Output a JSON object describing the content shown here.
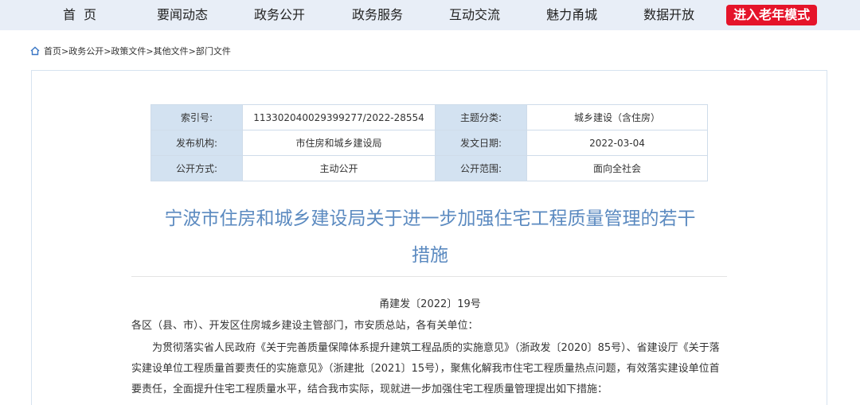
{
  "nav": {
    "items": [
      "首页",
      "要闻动态",
      "政务公开",
      "政务服务",
      "互动交流",
      "魅力甬城",
      "数据开放"
    ],
    "elder_mode": "进入老年模式"
  },
  "breadcrumb": "首页>政务公开>政策文件>其他文件>部门文件",
  "meta": {
    "index_label": "索引号:",
    "index_value": "113302040029399277/2022-28554",
    "topic_label": "主题分类:",
    "topic_value": "城乡建设（含住房）",
    "org_label": "发布机构:",
    "org_value": "市住房和城乡建设局",
    "date_label": "发文日期:",
    "date_value": "2022-03-04",
    "mode_label": "公开方式:",
    "mode_value": "主动公开",
    "scope_label": "公开范围:",
    "scope_value": "面向全社会"
  },
  "article": {
    "title_line1": "宁波市住房和城乡建设局关于进一步加强住宅工程质量管理的若干",
    "title_line2": "措施",
    "doc_number": "甬建发〔2022〕19号",
    "salutation": "各区（县、市）、开发区住房城乡建设主管部门，市安质总站，各有关单位：",
    "para1": "为贯彻落实省人民政府《关于完善质量保障体系提升建筑工程品质的实施意见》（浙政发〔2020〕85号）、省建设厅《关于落实建设单位工程质量首要责任的实施意见》（浙建批〔2021〕15号），聚焦化解我市住宅工程质量热点问题，有效落实建设单位首要责任，全面提升住宅工程质量水平，结合我市实际，现就进一步加强住宅工程质量管理提出如下措施："
  },
  "colors": {
    "nav_bg": "#e8eef7",
    "elder_btn": "#e5142a",
    "title": "#5b8ac0",
    "label_bg": "#d3e2f1"
  }
}
